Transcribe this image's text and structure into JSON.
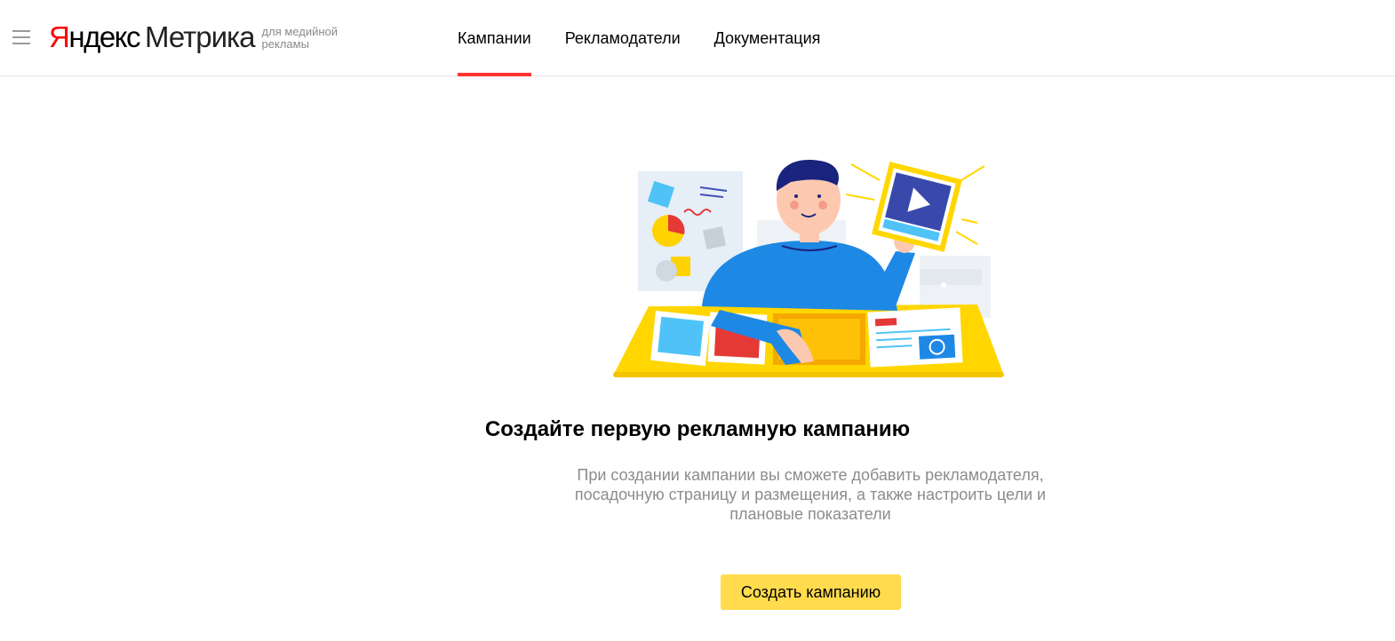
{
  "header": {
    "logo": {
      "brand_first_letter": "Я",
      "brand_rest": "ндекс",
      "product": "Метрика",
      "subtitle": "для медийной рекламы"
    },
    "nav": [
      {
        "label": "Кампании",
        "active": true
      },
      {
        "label": "Рекламодатели",
        "active": false
      },
      {
        "label": "Документация",
        "active": false
      }
    ],
    "menu_icon": "hamburger-icon"
  },
  "empty_state": {
    "illustration": "man-at-desk-with-video-tablet",
    "title": "Создайте первую рекламную кампанию",
    "description": "При создании кампании вы сможете добавить рекламодателя, посадочную страницу и размещения, а также настроить цели и плановые показатели",
    "button_label": "Создать кампанию"
  },
  "colors": {
    "accent_red": "#ff3333",
    "button_yellow": "#ffdb4d",
    "muted_text": "#8c8c8c"
  }
}
